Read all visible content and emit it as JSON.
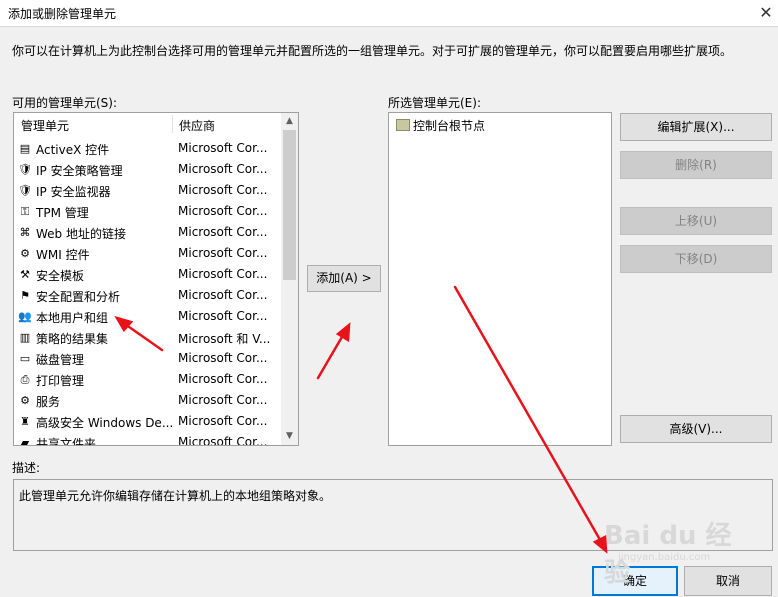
{
  "window": {
    "title": "添加或删除管理单元"
  },
  "intro_text": "你可以在计算机上为此控制台选择可用的管理单元并配置所选的一组管理单元。对于可扩展的管理单元，你可以配置要启用哪些扩展项。",
  "available": {
    "label": "可用的管理单元(S):",
    "columns": [
      "管理单元",
      "供应商"
    ],
    "rows": [
      {
        "name": "ActiveX 控件",
        "vendor": "Microsoft Cor...",
        "icon": "activex-icon"
      },
      {
        "name": "IP 安全策略管理",
        "vendor": "Microsoft Cor...",
        "icon": "ip-policy-icon"
      },
      {
        "name": "IP 安全监视器",
        "vendor": "Microsoft Cor...",
        "icon": "ip-monitor-icon"
      },
      {
        "name": "TPM 管理",
        "vendor": "Microsoft Cor...",
        "icon": "tpm-icon"
      },
      {
        "name": "Web 地址的链接",
        "vendor": "Microsoft Cor...",
        "icon": "web-link-icon"
      },
      {
        "name": "WMI 控件",
        "vendor": "Microsoft Cor...",
        "icon": "wmi-icon"
      },
      {
        "name": "安全模板",
        "vendor": "Microsoft Cor...",
        "icon": "security-template-icon"
      },
      {
        "name": "安全配置和分析",
        "vendor": "Microsoft Cor...",
        "icon": "security-config-icon"
      },
      {
        "name": "本地用户和组",
        "vendor": "Microsoft Cor...",
        "icon": "local-users-icon"
      },
      {
        "name": "策略的结果集",
        "vendor": "Microsoft 和 V...",
        "icon": "policy-result-icon"
      },
      {
        "name": "磁盘管理",
        "vendor": "Microsoft Cor...",
        "icon": "disk-icon"
      },
      {
        "name": "打印管理",
        "vendor": "Microsoft Cor...",
        "icon": "printer-icon"
      },
      {
        "name": "服务",
        "vendor": "Microsoft Cor...",
        "icon": "services-icon"
      },
      {
        "name": "高级安全 Windows De...",
        "vendor": "Microsoft Cor...",
        "icon": "firewall-icon"
      },
      {
        "name": "共享文件夹",
        "vendor": "Microsoft Cor...",
        "icon": "shared-folder-icon"
      }
    ]
  },
  "add_button": "添加(A) >",
  "selected": {
    "label": "所选管理单元(E):",
    "root": "控制台根节点"
  },
  "buttons": {
    "edit_ext": "编辑扩展(X)...",
    "remove": "删除(R)",
    "move_up": "上移(U)",
    "move_down": "下移(D)",
    "advanced": "高级(V)...",
    "ok": "确定",
    "cancel": "取消"
  },
  "description": {
    "label": "描述:",
    "text": "此管理单元允许你编辑存储在计算机上的本地组策略对象。"
  },
  "watermark": {
    "logo": "Bai du 经验",
    "sub": "jingyan.baidu.com"
  },
  "colors": {
    "accent": "#0078d7",
    "annotation": "#e8131a"
  }
}
